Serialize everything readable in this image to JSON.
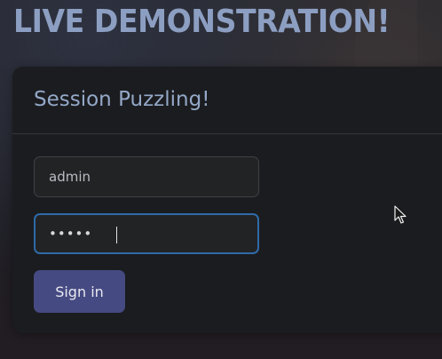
{
  "page": {
    "headline": "LIVE DEMONSTRATION!"
  },
  "login_card": {
    "title": "Session Puzzling!",
    "username": {
      "value": "admin"
    },
    "password": {
      "masked_value": "•••••",
      "focused": true
    },
    "submit_label": "Sign in"
  },
  "colors": {
    "headline": "#8c9fc2",
    "card_background": "#1b1c1f",
    "title_text": "#94a8c8",
    "focus_ring": "#2f6aa8",
    "button": "#464a82"
  },
  "icons": {
    "pointer": "mouse-pointer-icon"
  }
}
